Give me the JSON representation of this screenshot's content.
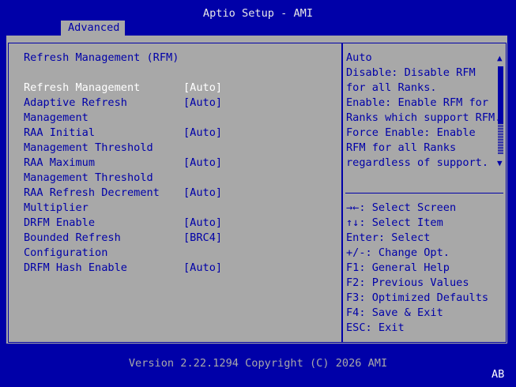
{
  "header": {
    "title": "Aptio Setup - AMI",
    "tab": "Advanced"
  },
  "section_title": "Refresh Management (RFM)",
  "settings": [
    {
      "label": [
        "Refresh Management"
      ],
      "value": "[Auto]",
      "selected": true
    },
    {
      "label": [
        "Adaptive Refresh",
        "Management"
      ],
      "value": "[Auto]"
    },
    {
      "label": [
        "RAA Initial",
        "Management Threshold"
      ],
      "value": "[Auto]"
    },
    {
      "label": [
        "RAA Maximum",
        "Management Threshold"
      ],
      "value": "[Auto]"
    },
    {
      "label": [
        "RAA Refresh Decrement",
        "Multiplier"
      ],
      "value": "[Auto]"
    },
    {
      "label": [
        "DRFM Enable"
      ],
      "value": "[Auto]"
    },
    {
      "label": [
        "Bounded Refresh",
        "Configuration"
      ],
      "value": "[BRC4]"
    },
    {
      "label": [
        "DRFM Hash Enable"
      ],
      "value": "[Auto]"
    }
  ],
  "help_text": [
    "Auto",
    "Disable: Disable RFM",
    "for all Ranks.",
    "Enable: Enable RFM for",
    "Ranks which support RFM.",
    "Force Enable: Enable",
    "RFM for all Ranks",
    "regardless of support."
  ],
  "keys": [
    {
      "key": "→←:",
      "desc": " Select Screen"
    },
    {
      "key": "↑↓:",
      "desc": " Select Item"
    },
    {
      "key": "Enter:",
      "desc": " Select"
    },
    {
      "key": "+/-:",
      "desc": " Change Opt."
    },
    {
      "key": "F1:",
      "desc": " General Help"
    },
    {
      "key": "F2:",
      "desc": " Previous Values"
    },
    {
      "key": "F3:",
      "desc": " Optimized Defaults"
    },
    {
      "key": "F4:",
      "desc": " Save & Exit"
    },
    {
      "key": "ESC:",
      "desc": " Exit"
    }
  ],
  "footer": {
    "version": "Version 2.22.1294 Copyright (C) 2026 AMI",
    "indicator": "AB"
  },
  "colors": {
    "background": "#0000a8",
    "panel": "#a8a8a8",
    "highlight": "#ffffff"
  }
}
